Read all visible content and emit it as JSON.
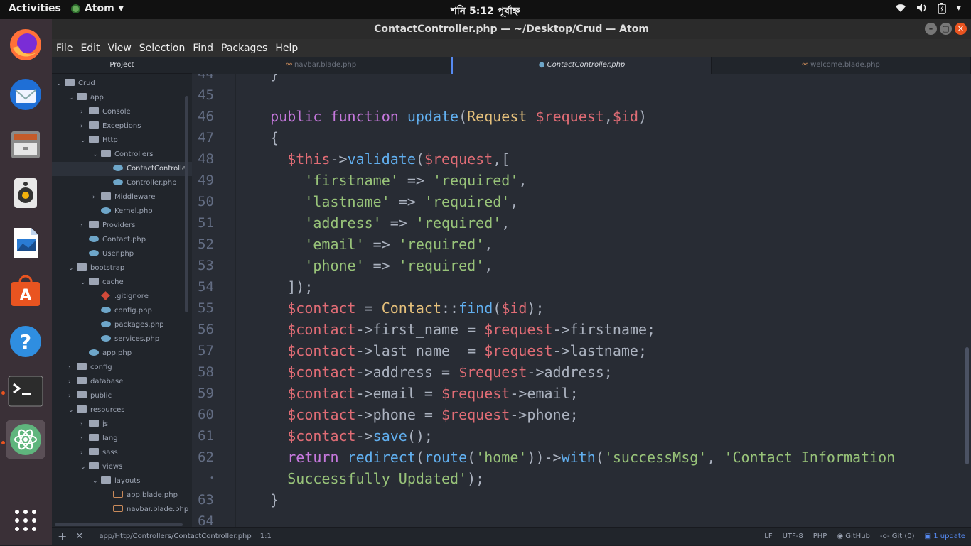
{
  "topbar": {
    "activities": "Activities",
    "app_name": "Atom",
    "clock": "শনি  5:12 পূর্বাহ্ন"
  },
  "window": {
    "title": "ContactController.php — ~/Desktop/Crud — Atom"
  },
  "menu": [
    "File",
    "Edit",
    "View",
    "Selection",
    "Find",
    "Packages",
    "Help"
  ],
  "tree": {
    "header": "Project",
    "items": [
      {
        "label": "Crud",
        "depth": 0,
        "type": "folder",
        "open": true
      },
      {
        "label": "app",
        "depth": 1,
        "type": "folder",
        "open": true
      },
      {
        "label": "Console",
        "depth": 2,
        "type": "folder",
        "open": false
      },
      {
        "label": "Exceptions",
        "depth": 2,
        "type": "folder",
        "open": false
      },
      {
        "label": "Http",
        "depth": 2,
        "type": "folder",
        "open": true
      },
      {
        "label": "Controllers",
        "depth": 3,
        "type": "folder",
        "open": true
      },
      {
        "label": "ContactControlle",
        "depth": 4,
        "type": "php",
        "selected": true
      },
      {
        "label": "Controller.php",
        "depth": 4,
        "type": "php"
      },
      {
        "label": "Middleware",
        "depth": 3,
        "type": "folder",
        "open": false
      },
      {
        "label": "Kernel.php",
        "depth": 3,
        "type": "php"
      },
      {
        "label": "Providers",
        "depth": 2,
        "type": "folder",
        "open": false
      },
      {
        "label": "Contact.php",
        "depth": 2,
        "type": "php"
      },
      {
        "label": "User.php",
        "depth": 2,
        "type": "php"
      },
      {
        "label": "bootstrap",
        "depth": 1,
        "type": "folder",
        "open": true
      },
      {
        "label": "cache",
        "depth": 2,
        "type": "folder",
        "open": true
      },
      {
        "label": ".gitignore",
        "depth": 3,
        "type": "git"
      },
      {
        "label": "config.php",
        "depth": 3,
        "type": "php"
      },
      {
        "label": "packages.php",
        "depth": 3,
        "type": "php"
      },
      {
        "label": "services.php",
        "depth": 3,
        "type": "php"
      },
      {
        "label": "app.php",
        "depth": 2,
        "type": "php"
      },
      {
        "label": "config",
        "depth": 1,
        "type": "folder",
        "open": false
      },
      {
        "label": "database",
        "depth": 1,
        "type": "folder",
        "open": false
      },
      {
        "label": "public",
        "depth": 1,
        "type": "folder",
        "open": false
      },
      {
        "label": "resources",
        "depth": 1,
        "type": "folder",
        "open": true
      },
      {
        "label": "js",
        "depth": 2,
        "type": "folder",
        "open": false
      },
      {
        "label": "lang",
        "depth": 2,
        "type": "folder",
        "open": false
      },
      {
        "label": "sass",
        "depth": 2,
        "type": "folder",
        "open": false
      },
      {
        "label": "views",
        "depth": 2,
        "type": "folder",
        "open": true
      },
      {
        "label": "layouts",
        "depth": 3,
        "type": "folder",
        "open": true
      },
      {
        "label": "app.blade.php",
        "depth": 4,
        "type": "blade"
      },
      {
        "label": "navbar.blade.php",
        "depth": 4,
        "type": "blade"
      }
    ]
  },
  "tabs": [
    {
      "label": "navbar.blade.php",
      "active": false
    },
    {
      "label": "ContactController.php",
      "active": true
    },
    {
      "label": "welcome.blade.php",
      "active": false
    }
  ],
  "editor": {
    "lines": [
      {
        "n": "44",
        "tokens": [
          [
            "",
            "    }"
          ]
        ]
      },
      {
        "n": "45",
        "tokens": []
      },
      {
        "n": "46",
        "tokens": [
          [
            "",
            "    "
          ],
          [
            "kw",
            "public"
          ],
          [
            "",
            " "
          ],
          [
            "kw",
            "function"
          ],
          [
            "",
            " "
          ],
          [
            "fn",
            "update"
          ],
          [
            "",
            "("
          ],
          [
            "cls",
            "Request"
          ],
          [
            "",
            " "
          ],
          [
            "var",
            "$request"
          ],
          [
            "",
            ","
          ],
          [
            "var",
            "$id"
          ],
          [
            "",
            ")"
          ]
        ]
      },
      {
        "n": "47",
        "tokens": [
          [
            "",
            "    {"
          ]
        ]
      },
      {
        "n": "48",
        "tokens": [
          [
            "",
            "      "
          ],
          [
            "var",
            "$this"
          ],
          [
            "",
            "->"
          ],
          [
            "fn",
            "validate"
          ],
          [
            "",
            "("
          ],
          [
            "var",
            "$request"
          ],
          [
            "",
            ",["
          ]
        ]
      },
      {
        "n": "49",
        "tokens": [
          [
            "",
            "        "
          ],
          [
            "str",
            "'firstname'"
          ],
          [
            "",
            " => "
          ],
          [
            "str",
            "'required'"
          ],
          [
            "",
            ","
          ]
        ]
      },
      {
        "n": "50",
        "tokens": [
          [
            "",
            "        "
          ],
          [
            "str",
            "'lastname'"
          ],
          [
            "",
            " => "
          ],
          [
            "str",
            "'required'"
          ],
          [
            "",
            ","
          ]
        ]
      },
      {
        "n": "51",
        "tokens": [
          [
            "",
            "        "
          ],
          [
            "str",
            "'address'"
          ],
          [
            "",
            " => "
          ],
          [
            "str",
            "'required'"
          ],
          [
            "",
            ","
          ]
        ]
      },
      {
        "n": "52",
        "tokens": [
          [
            "",
            "        "
          ],
          [
            "str",
            "'email'"
          ],
          [
            "",
            " => "
          ],
          [
            "str",
            "'required'"
          ],
          [
            "",
            ","
          ]
        ]
      },
      {
        "n": "53",
        "tokens": [
          [
            "",
            "        "
          ],
          [
            "str",
            "'phone'"
          ],
          [
            "",
            " => "
          ],
          [
            "str",
            "'required'"
          ],
          [
            "",
            ","
          ]
        ]
      },
      {
        "n": "54",
        "tokens": [
          [
            "",
            "      ]);"
          ]
        ]
      },
      {
        "n": "55",
        "tokens": [
          [
            "",
            "      "
          ],
          [
            "var",
            "$contact"
          ],
          [
            "",
            " = "
          ],
          [
            "cls",
            "Contact"
          ],
          [
            "",
            "::"
          ],
          [
            "fn",
            "find"
          ],
          [
            "",
            "("
          ],
          [
            "var",
            "$id"
          ],
          [
            "",
            ");"
          ]
        ]
      },
      {
        "n": "56",
        "tokens": [
          [
            "",
            "      "
          ],
          [
            "var",
            "$contact"
          ],
          [
            "",
            "->first_name = "
          ],
          [
            "var",
            "$request"
          ],
          [
            "",
            "->firstname;"
          ]
        ]
      },
      {
        "n": "57",
        "tokens": [
          [
            "",
            "      "
          ],
          [
            "var",
            "$contact"
          ],
          [
            "",
            "->last_name  = "
          ],
          [
            "var",
            "$request"
          ],
          [
            "",
            "->lastname;"
          ]
        ]
      },
      {
        "n": "58",
        "tokens": [
          [
            "",
            "      "
          ],
          [
            "var",
            "$contact"
          ],
          [
            "",
            "->address = "
          ],
          [
            "var",
            "$request"
          ],
          [
            "",
            "->address;"
          ]
        ]
      },
      {
        "n": "59",
        "tokens": [
          [
            "",
            "      "
          ],
          [
            "var",
            "$contact"
          ],
          [
            "",
            "->email = "
          ],
          [
            "var",
            "$request"
          ],
          [
            "",
            "->email;"
          ]
        ]
      },
      {
        "n": "60",
        "tokens": [
          [
            "",
            "      "
          ],
          [
            "var",
            "$contact"
          ],
          [
            "",
            "->phone = "
          ],
          [
            "var",
            "$request"
          ],
          [
            "",
            "->phone;"
          ]
        ]
      },
      {
        "n": "61",
        "tokens": [
          [
            "",
            "      "
          ],
          [
            "var",
            "$contact"
          ],
          [
            "",
            "->"
          ],
          [
            "fn",
            "save"
          ],
          [
            "",
            "();"
          ]
        ]
      },
      {
        "n": "62",
        "tokens": [
          [
            "",
            "      "
          ],
          [
            "kw",
            "return"
          ],
          [
            "",
            " "
          ],
          [
            "fn",
            "redirect"
          ],
          [
            "",
            "("
          ],
          [
            "fn",
            "route"
          ],
          [
            "",
            "("
          ],
          [
            "str",
            "'home'"
          ],
          [
            "",
            "))->"
          ],
          [
            "fn",
            "with"
          ],
          [
            "",
            "("
          ],
          [
            "str",
            "'successMsg'"
          ],
          [
            "",
            ", "
          ],
          [
            "str",
            "'Contact Information"
          ]
        ]
      },
      {
        "n": "•",
        "tokens": [
          [
            "",
            "      "
          ],
          [
            "str",
            "Successfully Updated'"
          ],
          [
            "",
            ");"
          ]
        ]
      },
      {
        "n": "63",
        "tokens": [
          [
            "",
            "    }"
          ]
        ]
      },
      {
        "n": "64",
        "tokens": []
      }
    ]
  },
  "status": {
    "path": "app/Http/Controllers/ContactController.php",
    "cursor": "1:1",
    "line_ending": "LF",
    "encoding": "UTF-8",
    "grammar": "PHP",
    "github": "GitHub",
    "git": "Git (0)",
    "updates": "1 update"
  },
  "icons": {
    "dock": [
      "firefox-icon",
      "thunderbird-icon",
      "files-icon",
      "rhythmbox-icon",
      "libreoffice-writer-icon",
      "software-icon",
      "help-icon",
      "terminal-icon",
      "atom-icon",
      "show-apps-icon"
    ]
  }
}
